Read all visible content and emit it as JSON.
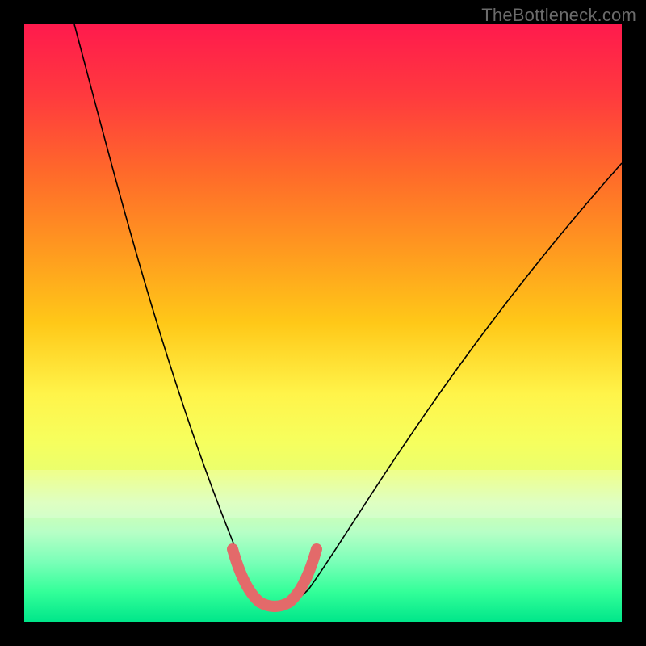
{
  "watermark": "TheBottleneck.com",
  "colors": {
    "background": "#000000",
    "curve": "#000000",
    "u_shape": "#e36a6a",
    "gradient_top": "#ff1a4d",
    "gradient_bottom": "#00e68a"
  },
  "chart_data": {
    "type": "line",
    "title": "",
    "xlabel": "",
    "ylabel": "",
    "xlim": [
      0,
      100
    ],
    "ylim": [
      0,
      100
    ],
    "grid": false,
    "legend": false,
    "series": [
      {
        "name": "bottleneck-curve",
        "x": [
          0,
          5,
          10,
          15,
          20,
          25,
          30,
          35,
          38,
          40,
          42,
          45,
          50,
          55,
          60,
          65,
          70,
          75,
          80,
          85,
          90,
          95,
          100
        ],
        "y": [
          100,
          88,
          76,
          64,
          53,
          42,
          31,
          18,
          9,
          4,
          2,
          4,
          9,
          16,
          24,
          32,
          40,
          48,
          55,
          62,
          68,
          73,
          78
        ]
      }
    ],
    "highlight": {
      "name": "optimal-u",
      "x_range": [
        35,
        48
      ],
      "y_value": 2
    },
    "background_style": "vertical-heat-gradient"
  }
}
